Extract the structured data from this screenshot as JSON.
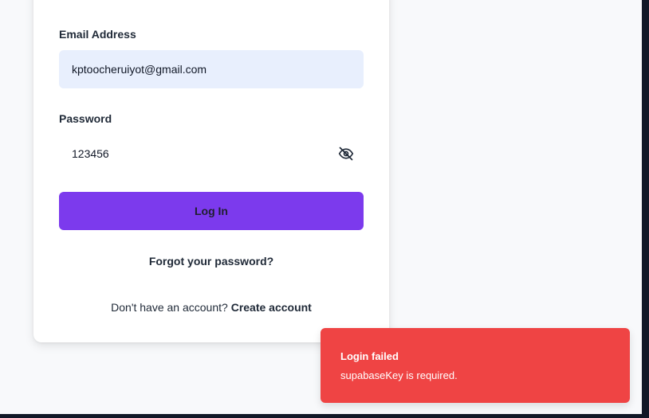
{
  "login_form": {
    "email_label": "Email Address",
    "email_value": "kptoocheruiyot@gmail.com",
    "password_label": "Password",
    "password_value": "123456",
    "password_toggle_icon": "eye-off-icon",
    "login_button_label": "Log In",
    "forgot_password_label": "Forgot your password?",
    "signup_prompt": "Don't have an account? ",
    "signup_link_label": "Create account"
  },
  "toast": {
    "title": "Login failed",
    "message": "supabaseKey is required."
  },
  "colors": {
    "accent": "#7c3aed",
    "error": "#ef4444",
    "email_input_bg": "#e8effd",
    "page_bg": "#f8f9fb"
  }
}
